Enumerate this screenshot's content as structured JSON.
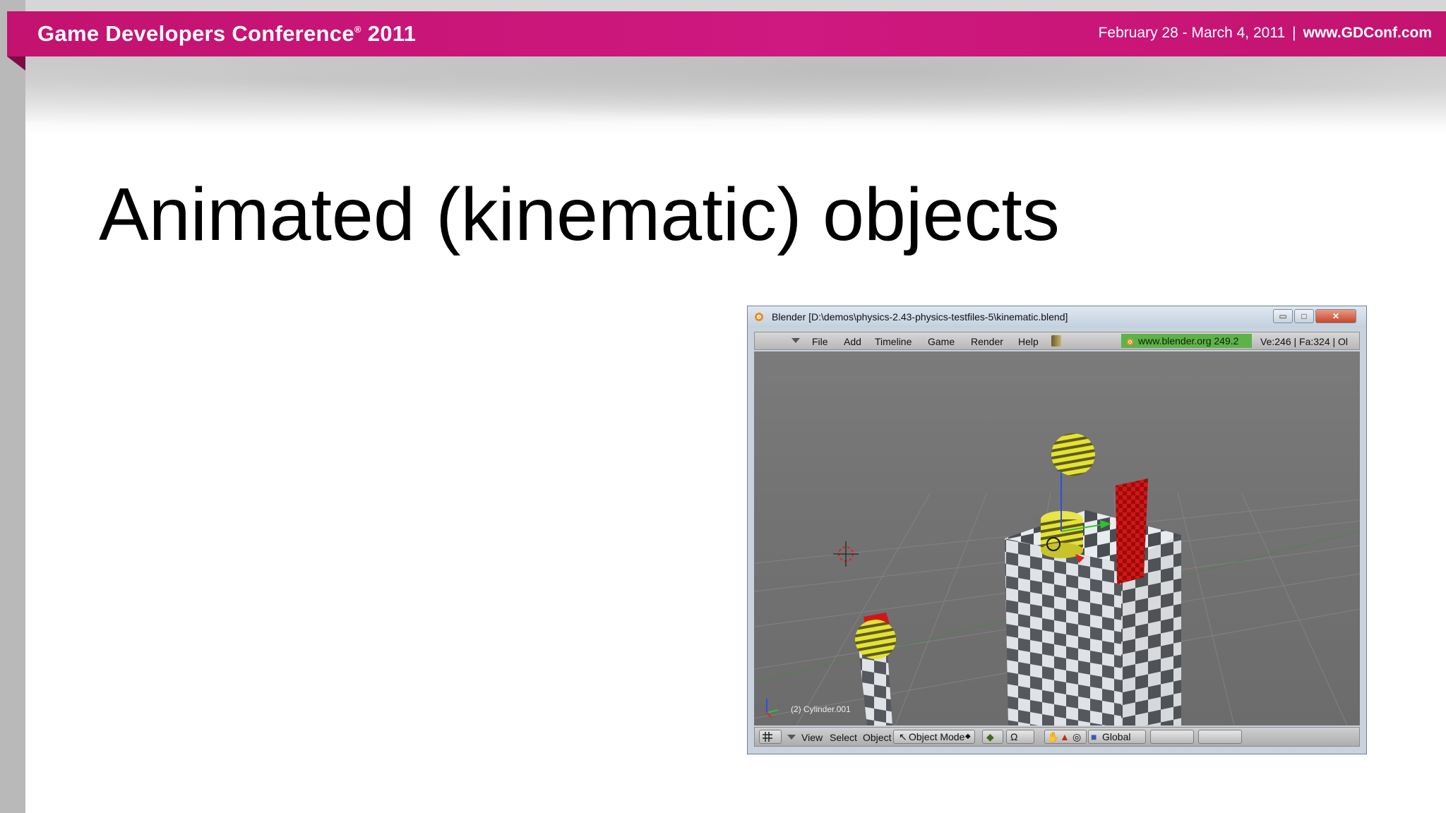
{
  "banner": {
    "title": "Game Developers Conference",
    "title_mark": "®",
    "year": "2011",
    "dates": "February 28 - March 4, 2011",
    "separator": "|",
    "url": "www.GDConf.com"
  },
  "slide": {
    "title": "Animated (kinematic) objects"
  },
  "blender": {
    "window_title": "Blender [D:\\demos\\physics-2.43-physics-testfiles-5\\kinematic.blend]",
    "window_controls": {
      "minimize": "▭",
      "maximize": "□",
      "close": "✕"
    },
    "menu": [
      "File",
      "Add",
      "Timeline",
      "Game",
      "Render",
      "Help"
    ],
    "site_badge": "www.blender.org 249.2",
    "stats": "Ve:246 | Fa:324 | Ol",
    "object_label": "(2) Cylinder.001",
    "bottom": {
      "view": "View",
      "select": "Select",
      "object": "Object",
      "mode": "Object Mode",
      "orientation": "Global"
    }
  },
  "colors": {
    "banner": "#c3126f",
    "badge": "#5fb24a",
    "viewport": "#737373",
    "sphere_yellow": "#e2e02a",
    "red_block": "#d11a1a"
  }
}
